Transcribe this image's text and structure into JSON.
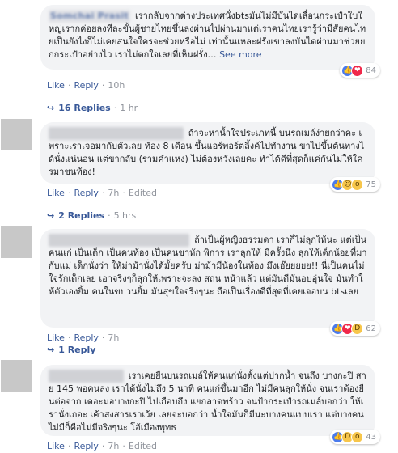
{
  "actions": {
    "like": "Like",
    "reply": "Reply"
  },
  "comments": [
    {
      "author": "Somchai Prasit",
      "text": "เรากลับจากต่างประเทศนั่งbtsมันไม่มีบันไดเลื่อนกระเป๋าใบใหญ่เรากค่อยลงทีละขั้นผู้ชายไทยขึ้นลงผ่านไปผ่านมาแต่เราคนไทยเรารู้ว่ามีสัยคนไทยเป็นยังไงก็ไม่เคยสนใจใครจะช่วยหรือไม่ เท่านั้นแหละฝรั่งเขาลงบันไดผ่านมาช่วยยกกระเป๋าอย่างไว เราไม่ตกใจเลยที่เห็นฝรั่ง…",
      "see_more": "See more",
      "time": "10h",
      "edited": "",
      "reactions": {
        "icons": [
          "like-icon",
          "love-icon"
        ],
        "count": "84"
      },
      "replies": {
        "label": "16 Replies",
        "time": "1 hr"
      }
    },
    {
      "author": "",
      "text": "ถ้าจะหาน้ำใจประเภทนี้ บนรถเมล์ง่ายกว่าคะ เพราะเราเจอมากับตัวเลย ท้อง 8 เดือน ขึ้นแอร์พอร์ตลิ้งค์ไปทำงาน ขาไปขึ้นต้นทางได้นั่งแน่นอน แต่ขากลับ (รามคำแหง) ไม่ต้องหวังเลยคะ ทำได้ดีที่สุดก็แค่กันไม่ให้ใครมาชนท้อง!",
      "see_more": "",
      "time": "7h",
      "edited": "Edited",
      "reactions": {
        "icons": [
          "like-icon",
          "sad-icon",
          "wow-icon"
        ],
        "count": "75"
      },
      "replies": {
        "label": "2 Replies",
        "time": "5 hrs"
      }
    },
    {
      "author": "",
      "text": "ถ้าเป็นผู้หญิงธรรมดา เราก็ไม่ลุกให้นะ แต่เป็นคนแก่ เป็นเด็ก เป็นคนท้อง เป็นคนขาหัก พิการ เราลุกให้ มีครั้งนึง ลุกให้เด็กน้อยที่มากับแม่ เด็กนั่งว่า ให้ม่าม้านั่งได้มั้ยครับ ม่าม้ามีน้องในท้อง มึงเอ๊ยยยยย!! นี่เป็นคนไม่ใจรักเด็กเลย เอาจริงๆก็ลุกให้เพราะจะลง สถน หน้าแล้ว แต่มันดีมันอบอุ่นใจ มันทำให้ตัวเองยิ้ม คนในขบวนยิ้ม มันสุขใจจริงๆนะ ถือเป็นเรื่องดีที่สุดที่เคยเจอบน btsเลย",
      "see_more": "",
      "time": "7h",
      "edited": "",
      "reactions": {
        "icons": [
          "like-icon",
          "love-icon",
          "haha-icon"
        ],
        "count": "62"
      },
      "replies": {
        "label": "1 Reply",
        "time": ""
      }
    },
    {
      "author": "",
      "text": "เราเคยยืนบนรถเมล์ให้คนแก่นั่งตั้งแต่ปากน้ำ จนถึง บางกะปิ สาย 145 พอคนลง เราได้นั่งไม่ถึง 5 นาที คนแก่ขึ้นมาอีก ไม่มีคนลุกให้นั่ง จนเราต้องยืนต่อจาก เดอะมอบางกะปิ ไปเกือบถึง แยกลาดพร้าว จนป้ากระเป๋ารถเมล์บอกว่า ให้เรานั่งเถอะ เค้าสงสารเราเว้ย เลยจะบอกว่า น้ำใจมันก็มีนะบางคนแบบเรา แต่บางคนไม่มีก็คือไม่มีจริงๆนะ โอ้เมืองพุทธ",
      "see_more": "",
      "time": "7h",
      "edited": "Edited",
      "reactions": {
        "icons": [
          "like-icon",
          "haha-icon",
          "wow-icon"
        ],
        "count": "43"
      },
      "replies": {
        "label": "",
        "time": ""
      }
    }
  ]
}
